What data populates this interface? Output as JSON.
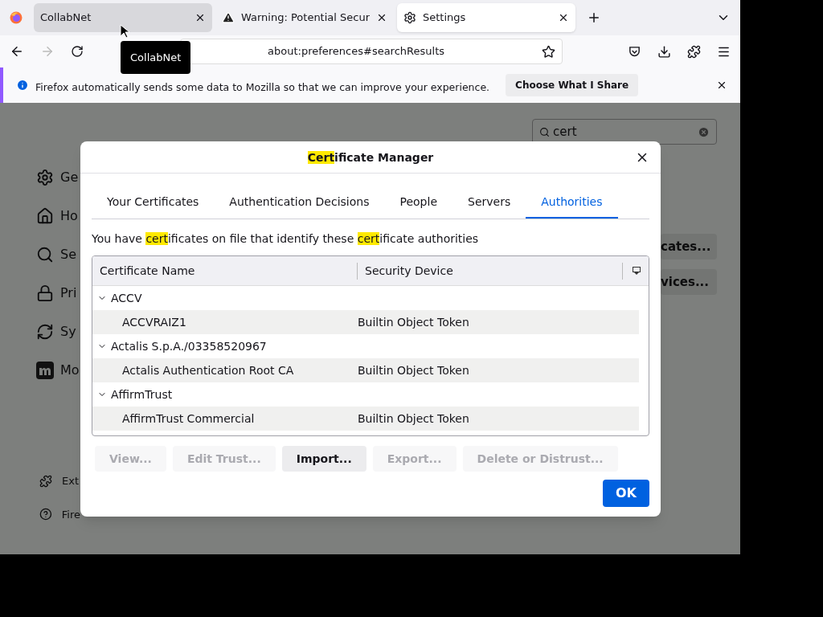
{
  "tabs": [
    {
      "label": "CollabNet",
      "selected": false
    },
    {
      "label": "Warning: Potential Secur",
      "selected": false
    },
    {
      "label": "Settings",
      "selected": true
    }
  ],
  "tooltip": "CollabNet",
  "address": "about:preferences#searchResults",
  "notification": {
    "text": "Firefox automatically sends some data to Mozilla so that we can improve your experience.",
    "button": "Choose What I Share"
  },
  "search": {
    "value": "cert"
  },
  "sidebar": [
    {
      "label": "Ge"
    },
    {
      "label": "Ho"
    },
    {
      "label": "Se"
    },
    {
      "label": "Pri"
    },
    {
      "label": "Sy"
    },
    {
      "label": "Mo"
    }
  ],
  "sidebar_footer": [
    {
      "label": "Ext"
    },
    {
      "label": "Fire"
    }
  ],
  "background_buttons": [
    "cates...",
    "vices..."
  ],
  "dialog": {
    "title": [
      {
        "text": "Cert",
        "highlight": true
      },
      {
        "text": "ificate Manager",
        "highlight": false
      }
    ],
    "tabs": [
      {
        "label": "Your Certificates",
        "selected": false
      },
      {
        "label": "Authentication Decisions",
        "selected": false
      },
      {
        "label": "People",
        "selected": false
      },
      {
        "label": "Servers",
        "selected": false
      },
      {
        "label": "Authorities",
        "selected": true
      }
    ],
    "description": [
      {
        "text": "You have ",
        "highlight": false
      },
      {
        "text": "cert",
        "highlight": true
      },
      {
        "text": "ificates on file that identify these ",
        "highlight": false
      },
      {
        "text": "cert",
        "highlight": true
      },
      {
        "text": "ificate authorities",
        "highlight": false
      }
    ],
    "table": {
      "columns": [
        "Certificate Name",
        "Security Device"
      ],
      "rows": [
        {
          "name": "ACCV",
          "expanded": true,
          "children": [
            {
              "name": "ACCVRAIZ1",
              "device": "Builtin Object Token"
            }
          ]
        },
        {
          "name": "Actalis S.p.A./03358520967",
          "expanded": true,
          "children": [
            {
              "name": "Actalis Authentication Root CA",
              "device": "Builtin Object Token"
            }
          ]
        },
        {
          "name": "AffirmTrust",
          "expanded": true,
          "children": [
            {
              "name": "AffirmTrust Commercial",
              "device": "Builtin Object Token"
            }
          ]
        }
      ]
    },
    "buttons": [
      {
        "label": "View...",
        "disabled": true
      },
      {
        "label": "Edit Trust...",
        "disabled": true
      },
      {
        "label": "Import...",
        "disabled": false
      },
      {
        "label": "Export...",
        "disabled": true
      },
      {
        "label": "Delete or Distrust...",
        "disabled": true
      }
    ],
    "ok": "OK"
  }
}
